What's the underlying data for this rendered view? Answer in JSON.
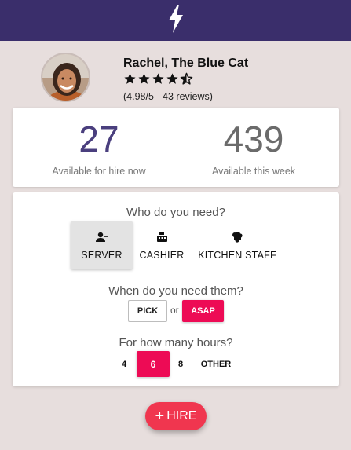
{
  "header": {
    "logo_icon": "lightning-bolt-icon",
    "background": "#3a2e6b"
  },
  "profile": {
    "name": "Rachel, The Blue Cat",
    "rating_value": 4.5,
    "rating_max": 5,
    "rating_text": "(4.98/5 - 43 reviews)"
  },
  "stats": {
    "available_now": {
      "value": "27",
      "label": "Available for hire now",
      "color": "#4a3f7e"
    },
    "available_week": {
      "value": "439",
      "label": "Available this week",
      "color": "#6b6b6b"
    }
  },
  "who": {
    "title": "Who do you need?",
    "options": [
      {
        "label": "SERVER",
        "icon": "person-icon",
        "selected": true
      },
      {
        "label": "CASHIER",
        "icon": "cash-register-icon",
        "selected": false
      },
      {
        "label": "KITCHEN STAFF",
        "icon": "chef-icon",
        "selected": false
      }
    ]
  },
  "when": {
    "title": "When do you need them?",
    "pick_label": "PICK",
    "or_label": "or",
    "asap_label": "ASAP"
  },
  "hours": {
    "title": "For how many hours?",
    "options": [
      {
        "label": "4",
        "selected": false
      },
      {
        "label": "6",
        "selected": true
      },
      {
        "label": "8",
        "selected": false
      },
      {
        "label": "OTHER",
        "selected": false
      }
    ]
  },
  "hire_button": {
    "plus": "+",
    "label": "HIRE"
  },
  "colors": {
    "accent": "#ed0b55",
    "hire": "#f0364f",
    "page_bg": "#e7dedd"
  }
}
